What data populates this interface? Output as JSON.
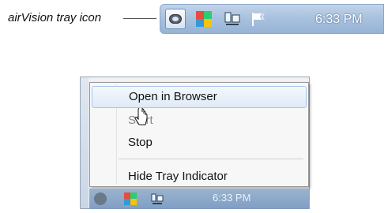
{
  "callout": {
    "label": "airVision tray icon"
  },
  "taskbar": {
    "tray_icons": [
      {
        "name": "airvision-tray-icon"
      },
      {
        "name": "avg-icon"
      },
      {
        "name": "network-icon"
      },
      {
        "name": "action-center-flag-icon"
      }
    ],
    "clock": "6:33 PM"
  },
  "context_menu": {
    "items": [
      {
        "label": "Open in Browser",
        "state": "hover"
      },
      {
        "label": "Start",
        "state": "disabled"
      },
      {
        "label": "Stop",
        "state": "enabled"
      },
      {
        "label": "Hide Tray Indicator",
        "state": "enabled"
      }
    ]
  },
  "colors": {
    "taskbar": "#a9c2de",
    "menu_background": "#f7f7f7",
    "hover_highlight": "#dfeaf7",
    "disabled_text": "#8a8a8a"
  }
}
